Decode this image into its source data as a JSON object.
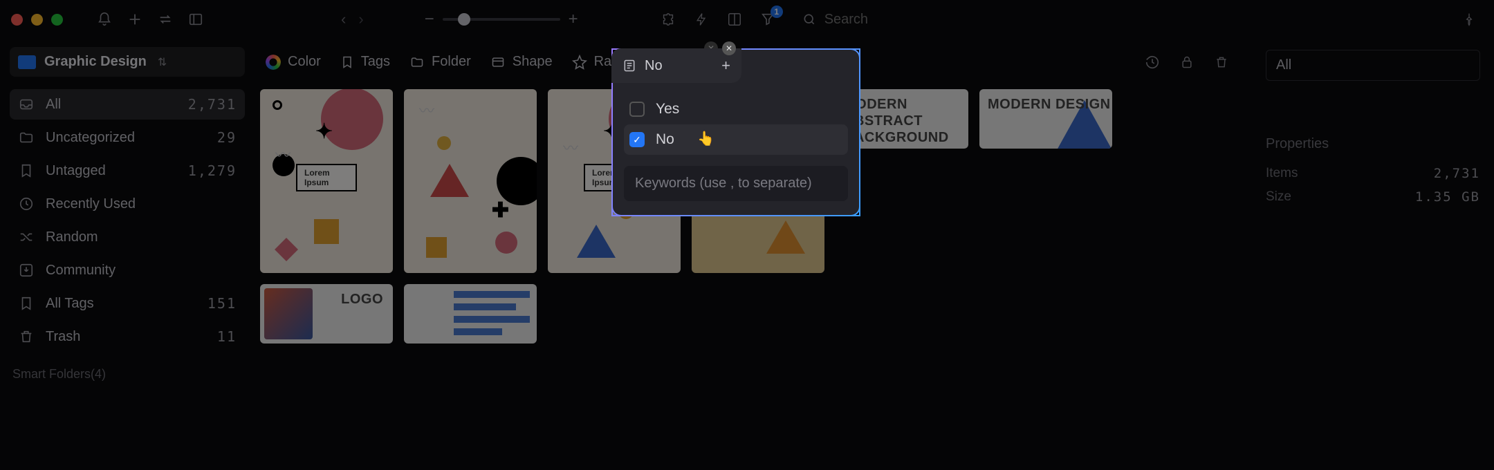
{
  "topbar": {
    "search_placeholder": "Search",
    "filter_badge": "1"
  },
  "sidebar": {
    "folder": "Graphic Design",
    "items": [
      {
        "label": "All",
        "count": "2,731",
        "icon": "inbox",
        "active": true
      },
      {
        "label": "Uncategorized",
        "count": "29",
        "icon": "folder-hash"
      },
      {
        "label": "Untagged",
        "count": "1,279",
        "icon": "bookmark-hash"
      },
      {
        "label": "Recently Used",
        "count": "",
        "icon": "clock"
      },
      {
        "label": "Random",
        "count": "",
        "icon": "shuffle"
      },
      {
        "label": "Community",
        "count": "",
        "icon": "download-box"
      },
      {
        "label": "All Tags",
        "count": "151",
        "icon": "bookmark"
      },
      {
        "label": "Trash",
        "count": "11",
        "icon": "trash"
      }
    ],
    "smart_folders": "Smart Folders(4)"
  },
  "filterbar": {
    "color": "Color",
    "tags": "Tags",
    "folder": "Folder",
    "shape": "Shape",
    "rating": "Rating",
    "note_label": "No"
  },
  "popover": {
    "tab_label": "No",
    "options": [
      {
        "label": "Yes",
        "checked": false
      },
      {
        "label": "No",
        "checked": true
      }
    ],
    "keywords_placeholder": "Keywords (use , to separate)"
  },
  "rightpanel": {
    "all_label": "All",
    "properties_label": "Properties",
    "items_label": "Items",
    "items_value": "2,731",
    "size_label": "Size",
    "size_value": "1.35 GB"
  },
  "cards": {
    "label": "Lorem Ipsum",
    "row2": [
      "MODERN ABSTRACT BACKGROUND",
      "MODERN DESIGN",
      "LOGO",
      ""
    ]
  }
}
